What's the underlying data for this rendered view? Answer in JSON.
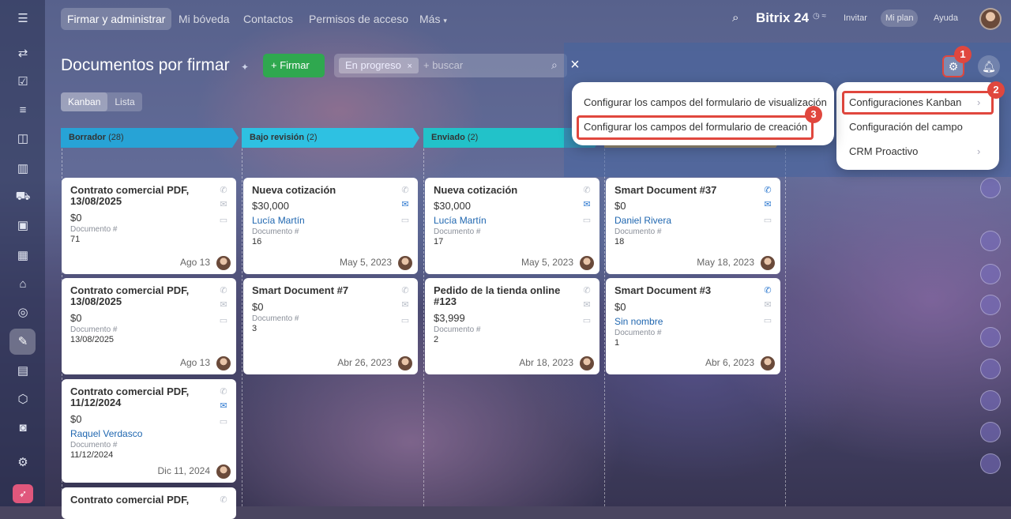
{
  "header": {
    "tabs": [
      "Firmar y administrar",
      "Mi bóveda",
      "Contactos",
      "Permisos de acceso",
      "Más"
    ],
    "brand": "Bitrix 24",
    "buttons": [
      "Invitar",
      "Mi plan",
      "Ayuda"
    ]
  },
  "page": {
    "title": "Documentos por firmar",
    "primary_button": "+ Firmar",
    "filter_chip": "En progreso",
    "search_placeholder": "+ buscar",
    "view_tabs": [
      "Kanban",
      "Lista"
    ]
  },
  "columns": [
    {
      "name": "Borrador",
      "count": "(28)",
      "color": "#27a3d6"
    },
    {
      "name": "Bajo revisión",
      "count": "(2)",
      "color": "#2ec1e2"
    },
    {
      "name": "Enviado",
      "count": "(2)",
      "color": "#22c2c9"
    }
  ],
  "doc_label": "Documento #",
  "cards": [
    {
      "title": "Contrato comercial PDF, 13/08/2025",
      "price": "$0",
      "person": "",
      "number": "71",
      "date": "Ago 13"
    },
    {
      "title": "Contrato comercial PDF, 13/08/2025",
      "price": "$0",
      "person": "",
      "number": "13/08/2025",
      "date": "Ago 13"
    },
    {
      "title": "Contrato comercial PDF, 11/12/2024",
      "price": "$0",
      "person": "Raquel Verdasco",
      "number": "11/12/2024",
      "date": "Dic 11, 2024"
    },
    {
      "title": "Contrato comercial PDF,",
      "price": "",
      "person": "",
      "number": "",
      "date": ""
    },
    {
      "title": "Nueva cotización",
      "price": "$30,000",
      "person": "Lucía Martín",
      "number": "16",
      "date": "May 5, 2023"
    },
    {
      "title": "Smart Document #7",
      "price": "$0",
      "person": "",
      "number": "3",
      "date": "Abr 26, 2023"
    },
    {
      "title": "Nueva cotización",
      "price": "$30,000",
      "person": "Lucía Martín",
      "number": "17",
      "date": "May 5, 2023"
    },
    {
      "title": "Pedido de la tienda online #123",
      "price": "$3,999",
      "person": "",
      "number": "2",
      "date": "Abr 18, 2023"
    },
    {
      "title": "Smart Document #37",
      "price": "$0",
      "person": "Daniel Rivera",
      "number": "18",
      "date": "May 18, 2023"
    },
    {
      "title": "Smart Document #3",
      "price": "$0",
      "person": "Sin nombre",
      "number": "1",
      "date": "Abr 6, 2023"
    }
  ],
  "settings_menu": {
    "items": [
      "Configuraciones Kanban",
      "Configuración del campo",
      "CRM Proactivo"
    ]
  },
  "submenu": {
    "items": [
      "Configurar los campos del formulario de visualización",
      "Configurar los campos del formulario de creación"
    ]
  },
  "badges": [
    "1",
    "2",
    "3"
  ]
}
